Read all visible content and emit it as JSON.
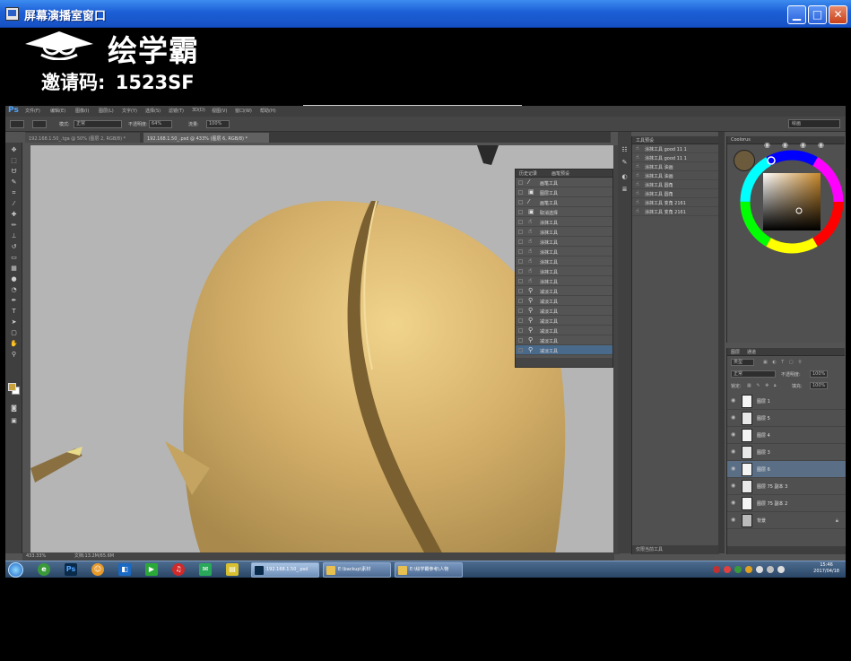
{
  "window": {
    "title": "屏幕演播室窗口",
    "min_glyph": "▁",
    "max_glyph": "□",
    "close_glyph": "✕"
  },
  "header": {
    "brand": "绘学霸",
    "invite_label": "邀请码:",
    "invite_code": "1523SF"
  },
  "photoshop": {
    "logo": "Ps",
    "menu": [
      "文件(F)",
      "编辑(E)",
      "图像(I)",
      "图层(L)",
      "文字(Y)",
      "选择(S)",
      "滤镜(T)",
      "3D(D)",
      "视图(V)",
      "窗口(W)",
      "帮助(H)"
    ],
    "options": {
      "mode_label": "模式:",
      "mode_value": "正常",
      "opacity_label": "不透明度:",
      "opacity_value": "64%",
      "flow_label": "流量:",
      "flow_value": "100%",
      "workspace": "绘画"
    },
    "tabs": [
      {
        "label": "192.168.1.50_.tga @ 50% (图层 2, RGB/8) *",
        "active": false
      },
      {
        "label": "192.168.1.50_.psd @ 433% (图层 6, RGB/8) *",
        "active": true
      }
    ],
    "status": {
      "zoom": "433.33%",
      "doc": "文档:13.2M/65.6M"
    },
    "history": {
      "tabs": [
        "历史记录",
        "画笔预设"
      ],
      "items": [
        {
          "icon": "brush",
          "label": "画笔工具"
        },
        {
          "icon": "layer",
          "label": "图层工具"
        },
        {
          "icon": "brush",
          "label": "画笔工具"
        },
        {
          "icon": "layer",
          "label": "取消选择"
        },
        {
          "icon": "smudge",
          "label": "涂抹工具"
        },
        {
          "icon": "smudge",
          "label": "涂抹工具"
        },
        {
          "icon": "smudge",
          "label": "涂抹工具"
        },
        {
          "icon": "smudge",
          "label": "涂抹工具"
        },
        {
          "icon": "smudge",
          "label": "涂抹工具"
        },
        {
          "icon": "smudge",
          "label": "涂抹工具"
        },
        {
          "icon": "smudge",
          "label": "涂抹工具"
        },
        {
          "icon": "dodge",
          "label": "减淡工具"
        },
        {
          "icon": "dodge",
          "label": "减淡工具"
        },
        {
          "icon": "dodge",
          "label": "减淡工具"
        },
        {
          "icon": "dodge",
          "label": "减淡工具"
        },
        {
          "icon": "dodge",
          "label": "减淡工具"
        },
        {
          "icon": "dodge",
          "label": "减淡工具"
        },
        {
          "icon": "dodge",
          "label": "减淡工具"
        }
      ],
      "active_index": 17
    },
    "tool_presets": {
      "title": "工具预设",
      "items": [
        "涂抹工具 good 11 1",
        "涂抹工具 good 11 1",
        "涂抹工具 油画",
        "涂抹工具 油画",
        "涂抹工具 圆角",
        "涂抹工具 圆角",
        "涂抹工具 变角 2161",
        "涂抹工具 变角 2161"
      ],
      "footer": "仅限当前工具"
    },
    "color": {
      "title": "Coolorus",
      "fg": "#6b5a3c"
    },
    "layers": {
      "tabs": [
        "图层",
        "通道"
      ],
      "kind": "类型",
      "blend": "正常",
      "opacity_label": "不透明度:",
      "opacity_value": "100%",
      "lock_label": "锁定:",
      "fill_label": "填充:",
      "fill_value": "100%",
      "items": [
        {
          "label": "图层 1",
          "active": false
        },
        {
          "label": "图层 5",
          "active": false
        },
        {
          "label": "图层 4",
          "active": false
        },
        {
          "label": "图层 3",
          "active": false
        },
        {
          "label": "图层 6",
          "active": true
        },
        {
          "label": "图层 75 副本 3",
          "active": false
        },
        {
          "label": "图层 75 副本 2",
          "active": false
        },
        {
          "label": "背景",
          "active": false
        }
      ]
    }
  },
  "taskbar": {
    "windows": [
      {
        "label": "192.168.1.50_.psd",
        "active": true
      },
      {
        "label": "E:\\backup\\素材",
        "active": false
      },
      {
        "label": "E:\\绘学霸参考\\人物",
        "active": false
      }
    ],
    "clock_time": "15:46",
    "clock_date": "2017/04/18"
  }
}
